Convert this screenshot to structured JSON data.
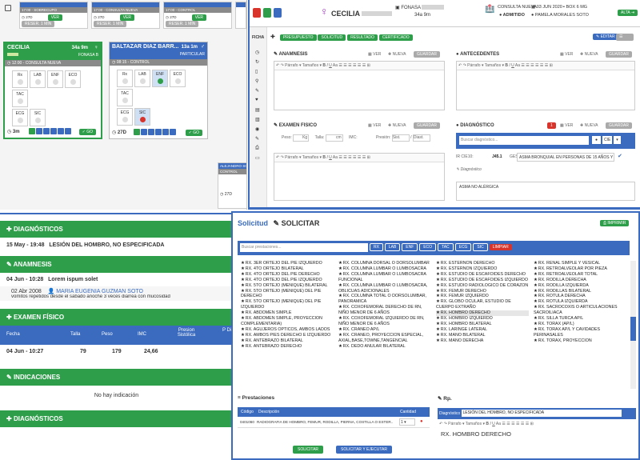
{
  "tl": {
    "top_rows": [
      {
        "label": "17:00 - SOBRECUPO"
      },
      {
        "label": "17:00 - CONSULTA NUEVA"
      },
      {
        "label": "17:00 - CONTROL"
      }
    ],
    "btn_ver": "VER",
    "btn_reser": "RESER. 1 MIN",
    "times": [
      "27D",
      "27D",
      "27D"
    ],
    "card1": {
      "name": "CECILIA",
      "age": "34a 9m",
      "insurer": "FONASA B",
      "appt": "12:00 - CONSULTA NUEVA",
      "wait": "3m"
    },
    "card2": {
      "name": "BALTAZAR DIAZ BARR...",
      "age": "13a 1m",
      "insurer": "PARTICULAR",
      "appt": "08:15 - CONTROL",
      "wait": "27D"
    },
    "tests_row1": [
      "Rx",
      "LAB",
      "ENF",
      "ECO",
      "TAC"
    ],
    "tests_row2": [
      "ECG",
      "SIC"
    ],
    "go": "GO",
    "side_card": {
      "header": "ALEJANDRO SOLIS",
      "appt": "CONTROL",
      "wait": "27D"
    }
  },
  "tr": {
    "patient_name": "CECILIA",
    "insurer": "FONASA B",
    "age": "34a 9m",
    "visit_type": "CONSULTA NUEVA",
    "date": "03 JUN 2020",
    "box": "BOX 6 MG",
    "status": "ADMITIDO",
    "doctor": "PAMELA MORALES SOTO",
    "alta": "ALTA",
    "side_label": "FICHA",
    "actions": [
      "PRESUPUESTO",
      "SOLICITUD",
      "RESULTADO",
      "CERTIFICADO"
    ],
    "editar": "EDITAR",
    "anamnesis": "ANAMNESIS",
    "antecedentes": "ANTECEDENTES",
    "ver": "VER",
    "nueva": "NUEVA",
    "guardar": "GUARDAR",
    "parrafo": "Párrafo",
    "tamanos": "Tamaños",
    "examen": "EXAMEN FISICO",
    "peso": "Peso:",
    "peso_unit": "Kg",
    "talla": "Talla:",
    "talla_unit": "cm",
    "imc": "IMC:",
    "presion": "Presión:",
    "sist": "Sist.",
    "diast": "Diast.",
    "diagnostico": "DIAGNÓSTICO",
    "diag_count": "1",
    "buscar_diag": "Buscar diagnóstico...",
    "cie": "CIE",
    "ir_cie": "IR CIE10:",
    "cie_code": "J45.1",
    "ges": "GES:",
    "diag_value": "ASMA BRONQUIAL EN PERSONAS DE 15 AÑOS Y",
    "diag_label": "Diagnóstico",
    "diag_note": "ASMA NO ALÉRGICA"
  },
  "bl": {
    "diag_title": "DIAGNÓSTICOS",
    "diag_date": "15 May - 19:48",
    "diag_text": "LESIÓN DEL HOMBRO, NO ESPECIFICADA",
    "anam_title": "ANAMNESIS",
    "anam_date": "04 Jun - 10:28",
    "anam_text": "Lorem ispum solet",
    "anam_date2": "02 Abr 2008",
    "anam_doctor": "MARIA EUGENIA GUZMAN SOTO",
    "anam_note": "vomitos repetidos desde el sabado anoche 3 veces diarrea con mucosidad",
    "ex_title": "EXAMEN FÍSICO",
    "ex_headers": [
      "Fecha",
      "Talla",
      "Peso",
      "IMC",
      "Presion Sistólica",
      "P Di"
    ],
    "ex_row": [
      "04 Jun - 10:27",
      "79",
      "179",
      "24,66"
    ],
    "ind_title": "INDICACIONES",
    "ind_empty": "No hay indicación",
    "diag2_title": "DIAGNÓSTICOS"
  },
  "br": {
    "solicitud": "Solicitud",
    "solicitar": "SOLICITAR",
    "imprimir": "IMPRIMIR",
    "search_ph": "Buscar prestaciones...",
    "filters": [
      "RX",
      "LAB",
      "ENF",
      "ECO",
      "TAC",
      "ECG",
      "SIC"
    ],
    "limpiar": "LIMPIAR",
    "col1": [
      "RX. 3ER ORTEJO DEL PIE IZQUIERDO",
      "RX. 4TO ORTEJO BILATERAL",
      "RX. 4TO ORTEJO DEL PIE DERECHO",
      "RX. 4TO ORTEJO DEL PIE IZQUIERDO",
      "RX. 5TO ORTEJO (MEÑIQUE) BILATERAL",
      "RX. 5TO ORTEJO (MEÑIQUE) DEL PIE DERECHO",
      "RX. 5TO ORTEJO (MEÑIQUE) DEL PIE IZQUIERDO",
      "RX. ABDOMEN SIMPLE",
      "RX. ABDOMEN SIMPLE, PROYECCION COMPLEMENTARIA)",
      "RX. AGUJEROS OPTICOS, AMBOS LADOS",
      "RX. AMBOS PIES DERECHO E IZQUIERDO",
      "RX. ANTEBRAZO BILATERAL",
      "RX. ANTEBRAZO DERECHO"
    ],
    "col2": [
      "RX. COLUMNA DORSAL O DORSOLUMBAR",
      "RX. COLUMNA LUMBAR O LUMBOSACRA",
      "RX. COLUMNA LUMBAR O LUMBOSACRA FUNCIONAL",
      "RX. COLUMNA LUMBAR O LUMBOSACRA, OBLICUAS ADICIONALES",
      "RX. COLUMNA TOTAL O DORSOLUMBAR, PANORAMICA",
      "RX. COXOFEMORAL DERECHO DE RN, NIÑO MENOR DE 6 AÑOS",
      "RX. COXOFEMORAL IZQUIERDO DE RN, NIÑO MENOR DE 6 AÑOS",
      "RX. CRANEO AP/L",
      "RX. CRANEO, PROYECCION ESPECIAL, AXIAL,BASE,TOWNE,TANGENCIAL",
      "RX. DEDO ANULAR BILATERAL"
    ],
    "col3": [
      "RX. ESTERNON DERECHO",
      "RX. ESTERNON IZQUIERDO",
      "RX. ESTUDIO DE ESCAFOIDES DERECHO",
      "RX. ESTUDIO DE ESCAFOIDES IZQUIERDO",
      "RX. ESTUDIO RADIOLOGICO DE CORAZON",
      "RX. FEMUR DERECHO",
      "RX. FEMUR IZQUIERDO",
      "RX. GLOBO OCULAR, ESTUDIO DE CUERPO EXTRAÑO",
      "RX. HOMBRO DERECHO",
      "RX. HOMBRO IZQUIERDO",
      "RX. HOMBRO BILATERAL",
      "RX. LARINGE LATERAL",
      "RX. MANO BILATERAL",
      "RX. MANO DERECHA"
    ],
    "col4": [
      "RX. RENAL SIMPLE Y VESICAL",
      "RX. RETROALVEOLAR POR PIEZA",
      "RX. RETROALVEOLAR TOTAL",
      "RX. RODILLA DERECHA",
      "RX. RODILLA IZQUIERDA",
      "RX. RODILLAS BILATERAL",
      "RX. ROTULA DERECHA",
      "RX. ROTULA IZQUIERDA",
      "RX. SACROCOXIS O ARTICULACIONES SACROILIACA",
      "RX. SILLA TURCA AP/L",
      "RX. TORAX (AP/L)",
      "RX. TORAX AP/L Y CAVIDADES PERINASALES",
      "RX. TORAX, PROYECCION"
    ],
    "prest_title": "Prestaciones",
    "prest_headers": [
      "Código",
      "Descripción",
      "Cantidad"
    ],
    "prest_code": "0401060",
    "prest_desc": "RADIOGRAFIA DE HOMBRO, FEMUR, RODILLA, PIERNA, COSTILLA O ESTER...",
    "prest_qty": "1",
    "btn_solicitar": "SOLICITAR",
    "btn_solicitar_ejecutar": "SOLICITAR Y EJECUTAR",
    "rp_title": "Rp.",
    "diag_label": "Diagnóstico",
    "diag_value": "LESIÓN DEL HOMBRO, NO ESPECIFICADA",
    "parrafo": "Párrafo",
    "tamanos": "Tamaños",
    "rp_text": "RX. HOMBRO DERECHO"
  }
}
